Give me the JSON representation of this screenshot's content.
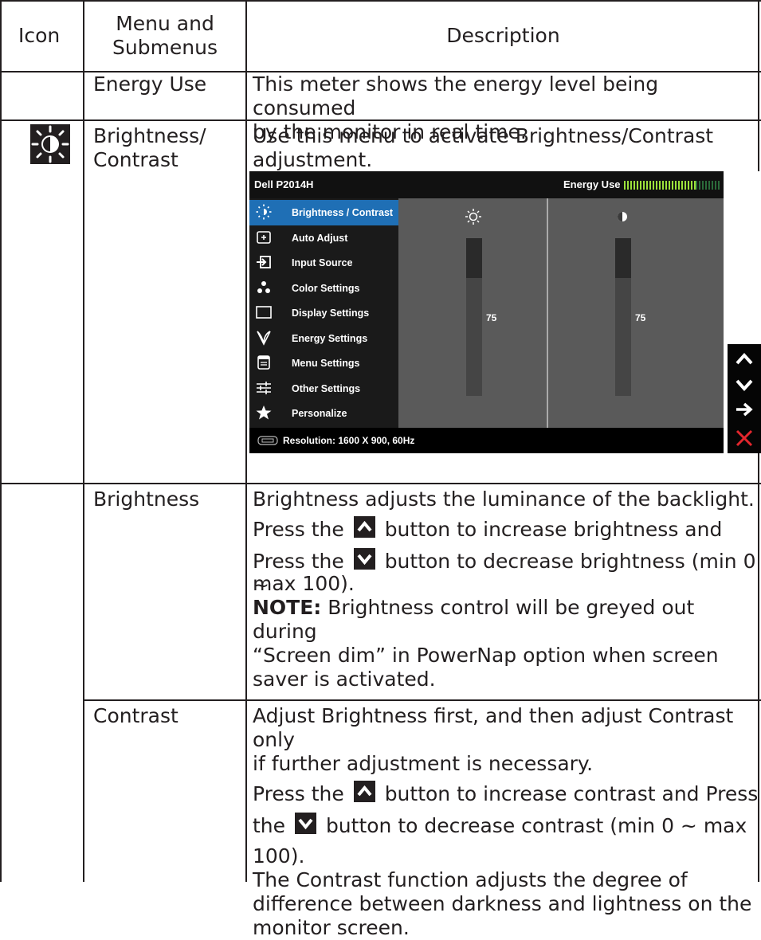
{
  "header": {
    "col_icon": "Icon",
    "col_menu_line1": "Menu and",
    "col_menu_line2": "Submenus",
    "col_desc": "Description"
  },
  "rows": {
    "energy_use": {
      "name": "Energy Use",
      "desc_line1": "This meter shows the energy level being consumed",
      "desc_line2": "by the monitor in real time."
    },
    "brightness_contrast": {
      "name_line1": "Brightness/",
      "name_line2": "Contrast",
      "icon": "brightness-contrast-icon",
      "desc_line1": "Use this menu to activate Brightness/Contrast",
      "desc_line2": "adjustment."
    },
    "brightness": {
      "name": "Brightness",
      "line1": "Brightness adjusts the luminance of the backlight.",
      "line2a": "Press the",
      "line2b": "button to increase brightness and",
      "line3a": "Press the",
      "line3b": "button to decrease brightness (min 0 ~",
      "line4": "max 100).",
      "note_label": "NOTE:",
      "note_line1": " Brightness control will be greyed out during",
      "note_line2": "“Screen dim” in PowerNap option when screen",
      "note_line3": "saver is activated."
    },
    "contrast": {
      "name": "Contrast",
      "line1": "Adjust Brightness first, and then adjust Contrast only",
      "line2": "if further adjustment is necessary.",
      "line3a": "Press the",
      "line3b": " button to increase contrast and Press",
      "line4a": "the",
      "line4b": "button to decrease contrast (min 0 ~ max",
      "line5": "100).",
      "line6": "The Contrast function adjusts the degree of",
      "line7": "difference between darkness and lightness on the",
      "line8": "monitor screen."
    }
  },
  "osd": {
    "model": "Dell P2014H",
    "energy_label": "Energy Use",
    "energy_meter_level": 0.75,
    "menu_items": [
      {
        "label": "Brightness / Contrast",
        "icon": "sun-icon",
        "selected": true
      },
      {
        "label": "Auto Adjust",
        "icon": "auto-adjust-icon"
      },
      {
        "label": "Input Source",
        "icon": "input-source-icon"
      },
      {
        "label": "Color Settings",
        "icon": "color-dots-icon"
      },
      {
        "label": "Display Settings",
        "icon": "display-icon"
      },
      {
        "label": "Energy Settings",
        "icon": "leaf-icon"
      },
      {
        "label": "Menu Settings",
        "icon": "menu-icon"
      },
      {
        "label": "Other Settings",
        "icon": "sliders-icon"
      },
      {
        "label": "Personalize",
        "icon": "star-icon"
      }
    ],
    "brightness_value": "75",
    "contrast_value": "75",
    "brightness_level": 0.75,
    "contrast_level": 0.75,
    "resolution": "Resolution: 1600 X 900, 60Hz",
    "nav_buttons": [
      "up-arrow-icon",
      "down-arrow-icon",
      "right-arrow-icon",
      "close-icon"
    ]
  }
}
